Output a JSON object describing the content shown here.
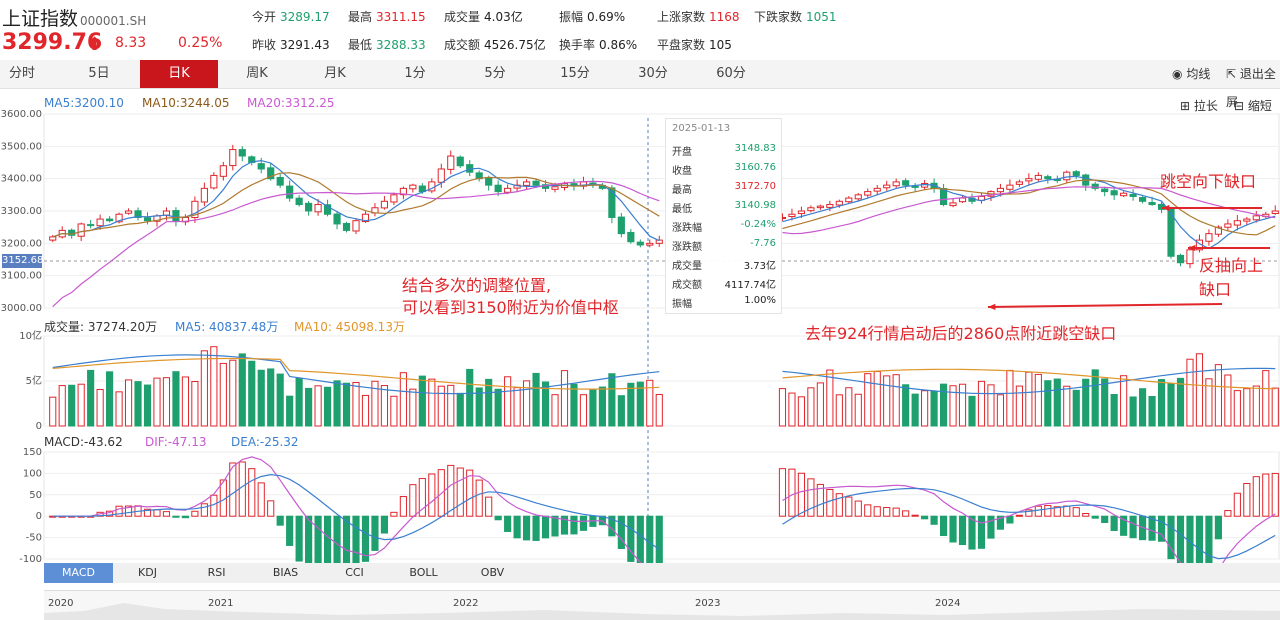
{
  "header": {
    "name": "上证指数",
    "code": "000001.SH",
    "price": "3299.76",
    "change": "8.33",
    "change_pct": "0.25%",
    "stats": [
      {
        "label": "今开",
        "value": "3289.17",
        "color": "#1e9f6e"
      },
      {
        "label": "最高",
        "value": "3311.15",
        "color": "#e0262b"
      },
      {
        "label": "成交量",
        "value": "4.03亿",
        "color": "#222222"
      },
      {
        "label": "振幅",
        "value": "0.69%",
        "color": "#222222"
      },
      {
        "label": "上涨家数",
        "value": "1168",
        "color": "#e0262b"
      },
      {
        "label": "下跌家数",
        "value": "1051",
        "color": "#1e9f6e"
      },
      {
        "label": "昨收",
        "value": "3291.43",
        "color": "#222222"
      },
      {
        "label": "最低",
        "value": "3288.33",
        "color": "#1e9f6e"
      },
      {
        "label": "成交额",
        "value": "4526.75亿",
        "color": "#222222"
      },
      {
        "label": "换手率",
        "value": "0.86%",
        "color": "#222222"
      },
      {
        "label": "平盘家数",
        "value": "105",
        "color": "#222222"
      }
    ]
  },
  "tabs": [
    "分时",
    "5日",
    "日K",
    "周K",
    "月K",
    "1分",
    "5分",
    "15分",
    "30分",
    "60分"
  ],
  "active_tab": "日K",
  "toolbar": {
    "ma_label": "均线",
    "exit_label": "退出全屏",
    "zoom_in": "拉长",
    "zoom_out": "缩短"
  },
  "ma_legend": {
    "ma5": "MA5:3200.10",
    "ma10": "MA10:3244.05",
    "ma20": "MA20:3312.25"
  },
  "vol_legend": {
    "vol": "成交量: 37274.20万",
    "ma5": "MA5: 40837.48万",
    "ma10": "MA10: 45098.13万"
  },
  "macd_legend": {
    "macd": "MACD:-43.62",
    "dif": "DIF:-47.13",
    "dea": "DEA:-25.32"
  },
  "price_tag": "3152.68",
  "tooltip": {
    "date": "2025-01-13",
    "rows": [
      {
        "k": "开盘",
        "v": "3148.83",
        "color": "#1e9f6e"
      },
      {
        "k": "收盘",
        "v": "3160.76",
        "color": "#1e9f6e"
      },
      {
        "k": "最高",
        "v": "3172.70",
        "color": "#e0262b"
      },
      {
        "k": "最低",
        "v": "3140.98",
        "color": "#1e9f6e"
      },
      {
        "k": "涨跌幅",
        "v": "-0.24%",
        "color": "#1e9f6e"
      },
      {
        "k": "涨跌额",
        "v": "-7.76",
        "color": "#1e9f6e"
      },
      {
        "k": "成交量",
        "v": "3.73亿",
        "color": "#222222"
      },
      {
        "k": "成交额",
        "v": "4117.74亿",
        "color": "#222222"
      },
      {
        "k": "振幅",
        "v": "1.00%",
        "color": "#222222"
      }
    ]
  },
  "annotations": {
    "a1": "结合多次的调整位置,",
    "a2": "可以看到3150附近为价值中枢",
    "a3": "跳空向下缺口",
    "a4": "反抽向上",
    "a5": "缺口",
    "a6": "去年924行情启动后的2860点附近跳空缺口"
  },
  "indicator_tabs": [
    "MACD",
    "KDJ",
    "RSI",
    "BIAS",
    "CCI",
    "BOLL",
    "OBV"
  ],
  "active_indicator": "MACD",
  "nav_years": [
    "2020",
    "2021",
    "2022",
    "2023",
    "2024"
  ],
  "chart_data": {
    "type": "candlestick",
    "price_axis": {
      "ticks": [
        "3600.00",
        "3500.00",
        "3400.00",
        "3300.00",
        "3200.00",
        "3100.00",
        "3000.00"
      ],
      "ylim": [
        3000,
        3600
      ]
    },
    "volume_axis": {
      "ticks": [
        "10亿",
        "5亿",
        "0"
      ],
      "ylim": [
        0,
        10
      ]
    },
    "macd_axis": {
      "ticks": [
        "150",
        "100",
        "50",
        "0",
        "-50",
        "-100"
      ],
      "ylim": [
        -100,
        150
      ]
    },
    "colors": {
      "up": "#e0262b",
      "down": "#1e9f6e",
      "ma5": "#3a7fd0",
      "ma10": "#b07a2e",
      "ma20": "#c859d0",
      "dif": "#c859d0",
      "dea": "#3a7fd0"
    },
    "closes": [
      3220,
      3240,
      3225,
      3260,
      3255,
      3275,
      3270,
      3290,
      3300,
      3280,
      3270,
      3285,
      3300,
      3270,
      3280,
      3330,
      3370,
      3410,
      3440,
      3490,
      3470,
      3450,
      3430,
      3400,
      3380,
      3340,
      3320,
      3300,
      3320,
      3290,
      3260,
      3240,
      3270,
      3290,
      3310,
      3330,
      3350,
      3370,
      3380,
      3360,
      3390,
      3430,
      3470,
      3440,
      3420,
      3400,
      3380,
      3360,
      3370,
      3380,
      3390,
      3380,
      3370,
      3375,
      3385,
      3380,
      3390,
      3380,
      3370,
      3280,
      3230,
      3205,
      3195,
      3200,
      3210,
      3185,
      3160,
      3180,
      3210,
      3220,
      3230,
      3228,
      3235,
      3250,
      3260,
      3270,
      3275,
      3280,
      3290,
      3300,
      3310,
      3315,
      3320,
      3330,
      3340,
      3350,
      3360,
      3370,
      3380,
      3390,
      3380,
      3375,
      3385,
      3370,
      3320,
      3325,
      3340,
      3330,
      3345,
      3360,
      3370,
      3380,
      3390,
      3400,
      3410,
      3400,
      3395,
      3420,
      3410,
      3380,
      3370,
      3360,
      3350,
      3355,
      3345,
      3330,
      3320,
      3305,
      3160,
      3140,
      3180,
      3210,
      3230,
      3250,
      3260,
      3270,
      3275,
      3285,
      3290,
      3300
    ]
  }
}
